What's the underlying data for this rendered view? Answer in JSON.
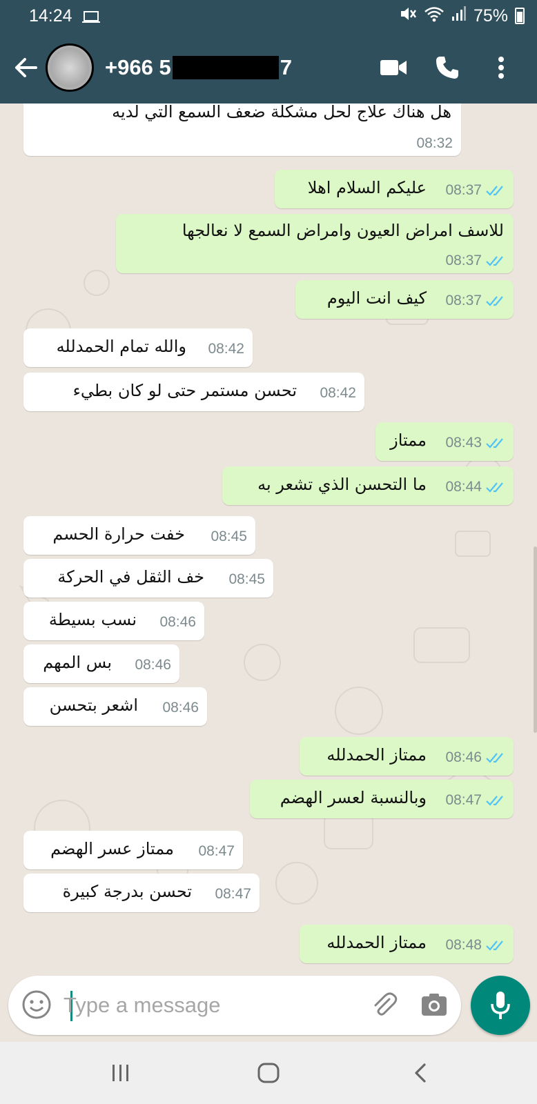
{
  "status_bar": {
    "time": "14:24",
    "battery": "75%",
    "icons": [
      "laptop-icon",
      "mute-icon",
      "wifi-icon",
      "signal-icon",
      "battery-icon"
    ]
  },
  "header": {
    "contact_prefix": "+966 5",
    "contact_suffix": "7",
    "icons": [
      "back-arrow-icon",
      "video-call-icon",
      "voice-call-icon",
      "more-options-icon"
    ]
  },
  "colors": {
    "header": "#2f4f5c",
    "outgoing_bubble": "#dcf8c6",
    "incoming_bubble": "#ffffff",
    "chat_background": "#ece5dd",
    "read_ticks": "#4fc3f7",
    "mic_button": "#00897b"
  },
  "messages": [
    {
      "dir": "in",
      "text": "هل هناك علاج لحل مشكلة ضعف السمع التي لديه",
      "time": "08:32"
    },
    {
      "dir": "out",
      "text": "عليكم السلام اهلا",
      "time": "08:37",
      "status": "read"
    },
    {
      "dir": "out",
      "text": "للاسف امراض العيون وامراض السمع لا نعالجها",
      "time": "08:37",
      "status": "read"
    },
    {
      "dir": "out",
      "text": "كيف انت اليوم",
      "time": "08:37",
      "status": "read"
    },
    {
      "dir": "in",
      "text": "والله تمام الحمدلله",
      "time": "08:42"
    },
    {
      "dir": "in",
      "text": "تحسن مستمر حتى لو كان بطيء",
      "time": "08:42"
    },
    {
      "dir": "out",
      "text": "ممتاز",
      "time": "08:43",
      "status": "read"
    },
    {
      "dir": "out",
      "text": "ما التحسن الذي تشعر به",
      "time": "08:44",
      "status": "read"
    },
    {
      "dir": "in",
      "text": "خفت حرارة الحسم",
      "time": "08:45"
    },
    {
      "dir": "in",
      "text": "خف الثقل في الحركة",
      "time": "08:45"
    },
    {
      "dir": "in",
      "text": "نسب بسيطة",
      "time": "08:46"
    },
    {
      "dir": "in",
      "text": "بس المهم",
      "time": "08:46"
    },
    {
      "dir": "in",
      "text": "اشعر بتحسن",
      "time": "08:46"
    },
    {
      "dir": "out",
      "text": "ممتاز الحمدلله",
      "time": "08:46",
      "status": "read"
    },
    {
      "dir": "out",
      "text": "وبالنسبة لعسر الهضم",
      "time": "08:47",
      "status": "read"
    },
    {
      "dir": "in",
      "text": "ممتاز عسر الهضم",
      "time": "08:47"
    },
    {
      "dir": "in",
      "text": "تحسن بدرجة كبيرة",
      "time": "08:47"
    },
    {
      "dir": "out",
      "text": "ممتاز الحمدلله",
      "time": "08:48",
      "status": "read"
    }
  ],
  "composer": {
    "placeholder": "Type a message",
    "icons": [
      "emoji-icon",
      "attach-icon",
      "camera-icon",
      "mic-icon"
    ]
  },
  "nav_bar": {
    "icons": [
      "recent-apps-icon",
      "home-icon",
      "back-icon"
    ]
  }
}
